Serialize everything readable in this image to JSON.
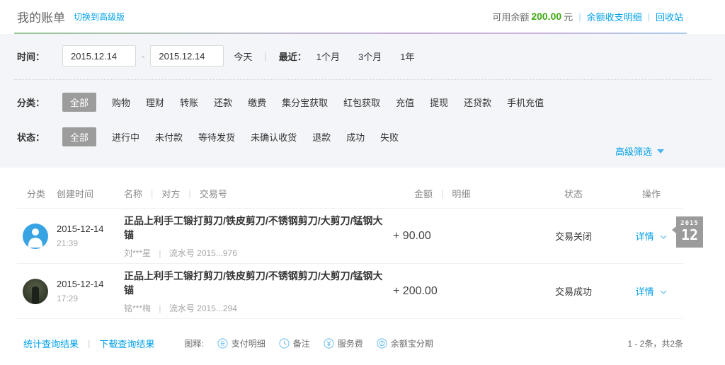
{
  "colors": {
    "link_blue": "#00a0e9",
    "balance_green": "#3fa913",
    "chip_grey": "#9c9c9c",
    "panel_bg": "#f3f5f8",
    "badge_grey": "#9b9b9b"
  },
  "misc": {
    "pipe": "|",
    "dash": "-"
  },
  "header": {
    "title": "我的账单",
    "switch_link": "切换到高级版",
    "balance_label": "可用余额",
    "balance_value": "200.00",
    "balance_unit": "元",
    "detail_link": "余额收支明细",
    "recycle_link": "回收站"
  },
  "filters": {
    "time_label": "时间：",
    "date_start": "2015.12.14",
    "date_end": "2015.12.14",
    "today": "今天",
    "recent_label": "最近：",
    "recent_options": [
      "1个月",
      "3个月",
      "1年"
    ],
    "category_label": "分类：",
    "category_options": [
      "全部",
      "购物",
      "理财",
      "转账",
      "还款",
      "缴费",
      "集分宝获取",
      "红包获取",
      "充值",
      "提现",
      "还贷款",
      "手机充值"
    ],
    "status_label": "状态：",
    "status_options": [
      "全部",
      "进行中",
      "未付款",
      "等待发货",
      "未确认收货",
      "退款",
      "成功",
      "失败"
    ],
    "advanced_link": "高级筛选"
  },
  "table": {
    "headers": {
      "category": "分类",
      "created": "创建时间",
      "name": "名称",
      "party": "对方",
      "txn": "交易号",
      "amount": "金额",
      "detail": "明细",
      "status": "状态",
      "action": "操作"
    },
    "rows": [
      {
        "avatar": "person-icon",
        "date": "2015-12-14",
        "time": "21:39",
        "title": "正品上利手工锻打剪刀/铁皮剪刀/不锈钢剪刀/大剪刀/锰钢大锚",
        "party": "刘***星",
        "serial": "流水号 2015...976",
        "amount": "+ 90.00",
        "status": "交易关闭",
        "action": "详情"
      },
      {
        "avatar": "user-photo",
        "date": "2015-12-14",
        "time": "17:29",
        "title": "正品上利手工锻打剪刀/铁皮剪刀/不锈钢剪刀/大剪刀/锰钢大锚",
        "party": "铭***梅",
        "serial": "流水号 2015...294",
        "amount": "+ 200.00",
        "status": "交易成功",
        "action": "详情"
      }
    ]
  },
  "date_badge": {
    "year": "2015",
    "month": "12"
  },
  "footer": {
    "stats_link": "统计查询结果",
    "download_link": "下载查询结果",
    "legend_label": "图释:",
    "legend": [
      {
        "icon": "payment-detail-circle-icon",
        "label": "支付明细"
      },
      {
        "icon": "note-clock-circle-icon",
        "label": "备注"
      },
      {
        "icon": "service-fee-yen-circle-icon",
        "label": "服务费"
      },
      {
        "icon": "yuebao-installment-circle-icon",
        "label": "余额宝分期"
      }
    ],
    "pagination": "1 - 2条，共2条"
  }
}
